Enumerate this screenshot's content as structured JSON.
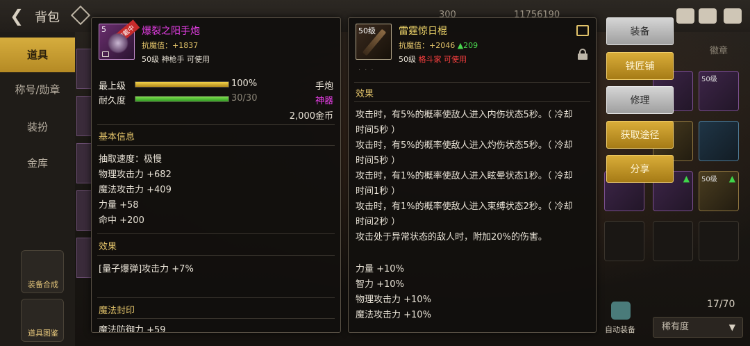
{
  "topbar": {
    "title": "背包",
    "currency_a": "300",
    "currency_b": "11756190"
  },
  "left_nav": {
    "items": [
      {
        "label": "道具",
        "active": true
      },
      {
        "label": "称号/勋章",
        "active": false
      },
      {
        "label": "装扮",
        "active": false
      },
      {
        "label": "金库",
        "active": false
      }
    ],
    "button_1": "装备合成",
    "button_2": "道具图鉴"
  },
  "left_card": {
    "name": "爆裂之阳手炮",
    "level_badge": "5",
    "equipped_badge": "穿戴中",
    "resist_label": "抗魔值：",
    "resist_value": "+1837",
    "requirement": "50级 神枪手 可使用",
    "max_level_label": "最上级",
    "max_level_value": "100%",
    "max_level_fraction": 1.0,
    "weapon_type": "手炮",
    "durability_label": "耐久度",
    "durability_value": "30/30",
    "durability_fraction": 1.0,
    "rarity": "神器",
    "price": "2,000金币",
    "basic_info_title": "基本信息",
    "stats": [
      "抽取速度：极慢",
      "物理攻击力 +682",
      "魔法攻击力 +409",
      "力量 +58",
      "命中 +200"
    ],
    "effect_title": "效果",
    "effect_line": "[量子爆弹]攻击力 +7%",
    "seal_title": "魔法封印",
    "seal_line": "魔法防御力 +59"
  },
  "right_card": {
    "level_badge": "50级",
    "name": "雷霆惊日棍",
    "resist_label": "抗魔值：",
    "resist_value": "+2046",
    "resist_delta": "▲209",
    "req_level": "50级",
    "req_class": "格斗家",
    "req_suffix": "可使用",
    "effect_title": "效果",
    "effect_lines": [
      "攻击时，有5%的概率使敌人进入内伤状态5秒。（ 冷却",
      "时间5秒 ）",
      "攻击时，有5%的概率使敌人进入灼伤状态5秒。（ 冷却",
      "时间5秒 ）",
      "攻击时，有1%的概率使敌人进入眩晕状态1秒。（ 冷却",
      "时间1秒 ）",
      "攻击时，有1%的概率使敌人进入束缚状态2秒。（ 冷却",
      "时间2秒 ）",
      "攻击处于异常状态的敌人时，附加20%的伤害。",
      "",
      "力量 +10%",
      "智力 +10%",
      "物理攻击力 +10%",
      "魔法攻击力 +10%"
    ]
  },
  "actions": {
    "equip": "装备",
    "blacksmith": "铁匠铺",
    "repair": "修理",
    "obtain": "获取途径",
    "share": "分享"
  },
  "inventory": {
    "tab": "徽章",
    "count": "17/70",
    "slot_level": "50级",
    "auto_equip": "自动装备",
    "sort_label": "稀有度"
  },
  "colors": {
    "epic_name": "#e63ee6",
    "legend_name": "#f0d66a",
    "gold_button": "#c9991f",
    "gray_button": "#bdbdbd",
    "stat_up": "#49d84f",
    "class_red": "#ff4040"
  }
}
